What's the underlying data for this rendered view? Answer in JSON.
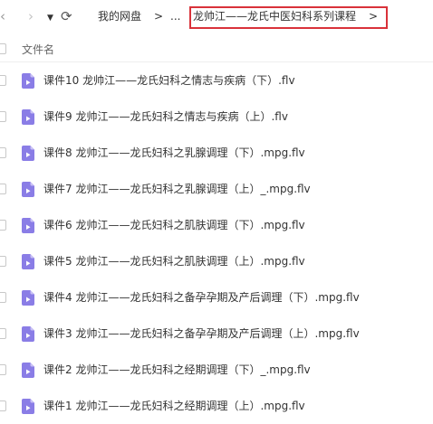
{
  "toolbar": {
    "back_glyph": "‹",
    "forward_glyph": "›",
    "history_glyph": "▼",
    "refresh_glyph": "⟳"
  },
  "breadcrumb": {
    "root": "我的网盘",
    "separator": ">",
    "ellipsis": "...",
    "current": "龙帅江——龙氏中医妇科系列课程",
    "trailing_separator": ">"
  },
  "list": {
    "column_name": "文件名",
    "file_icon": "video-file-icon",
    "icon_color": "#8a7de6",
    "files": [
      "课件10 龙帅江——龙氏妇科之情志与疾病（下）.flv",
      "课件9 龙帅江——龙氏妇科之情志与疾病（上）.flv",
      "课件8 龙帅江——龙氏妇科之乳腺调理（下）.mpg.flv",
      "课件7 龙帅江——龙氏妇科之乳腺调理（上）_.mpg.flv",
      "课件6 龙帅江——龙氏妇科之肌肤调理（下）.mpg.flv",
      "课件5 龙帅江——龙氏妇科之肌肤调理（上）.mpg.flv",
      "课件4 龙帅江——龙氏妇科之备孕孕期及产后调理（下）.mpg.flv",
      "课件3 龙帅江——龙氏妇科之备孕孕期及产后调理（上）.mpg.flv",
      "课件2 龙帅江——龙氏妇科之经期调理（下）_.mpg.flv",
      "课件1 龙帅江——龙氏妇科之经期调理（上）.mpg.flv"
    ]
  },
  "highlight_color": "#d9323a"
}
